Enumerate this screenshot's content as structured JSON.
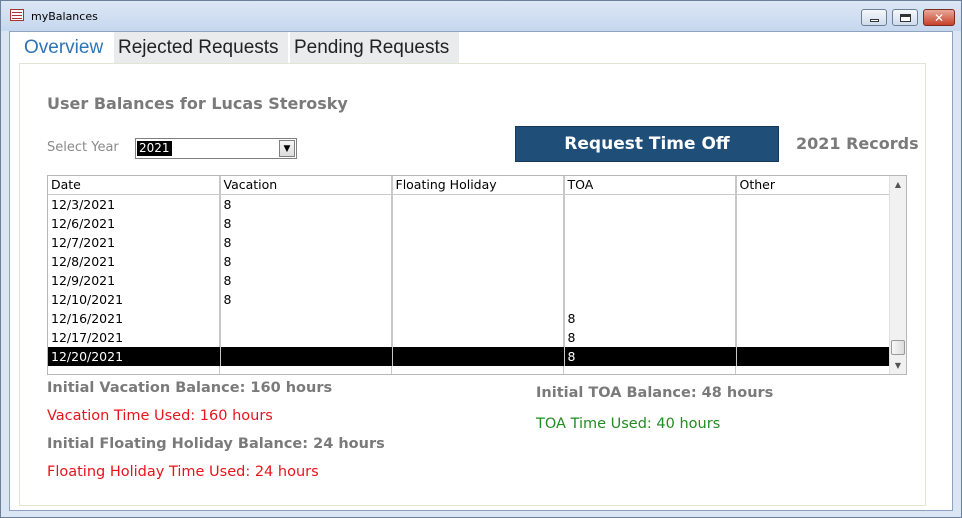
{
  "window": {
    "title": "myBalances"
  },
  "tabs": [
    {
      "label": "Overview",
      "active": true
    },
    {
      "label": "Rejected Requests",
      "active": false
    },
    {
      "label": "Pending Requests",
      "active": false
    }
  ],
  "overview": {
    "heading": "User Balances for Lucas Sterosky",
    "year_label": "Select Year",
    "year_value": "2021",
    "request_button": "Request Time Off",
    "records_label": "2021 Records"
  },
  "grid": {
    "columns": [
      "Date",
      "Vacation",
      "Floating Holiday",
      "TOA",
      "Other"
    ],
    "rows": [
      [
        "12/3/2021",
        "8",
        "",
        "",
        ""
      ],
      [
        "12/6/2021",
        "8",
        "",
        "",
        ""
      ],
      [
        "12/7/2021",
        "8",
        "",
        "",
        ""
      ],
      [
        "12/8/2021",
        "8",
        "",
        "",
        ""
      ],
      [
        "12/9/2021",
        "8",
        "",
        "",
        ""
      ],
      [
        "12/10/2021",
        "8",
        "",
        "",
        ""
      ],
      [
        "12/16/2021",
        "",
        "",
        "8",
        ""
      ],
      [
        "12/17/2021",
        "",
        "",
        "8",
        ""
      ],
      [
        "12/20/2021",
        "",
        "",
        "8",
        ""
      ]
    ],
    "selected_row": 8
  },
  "balances": {
    "initial_vacation": "Initial Vacation Balance:  160 hours",
    "vacation_used": "Vacation Time Used:  160 hours",
    "initial_floating": "Initial Floating Holiday Balance:  24 hours",
    "floating_used": "Floating Holiday Time Used:  24 hours",
    "initial_toa": "Initial TOA Balance:  48 hours",
    "toa_used": "TOA Time Used:  40 hours"
  },
  "colors": {
    "accent_tab": "#2e74b5",
    "button": "#1f4e79",
    "used_red": "#e8141b",
    "used_green": "#228b22"
  }
}
